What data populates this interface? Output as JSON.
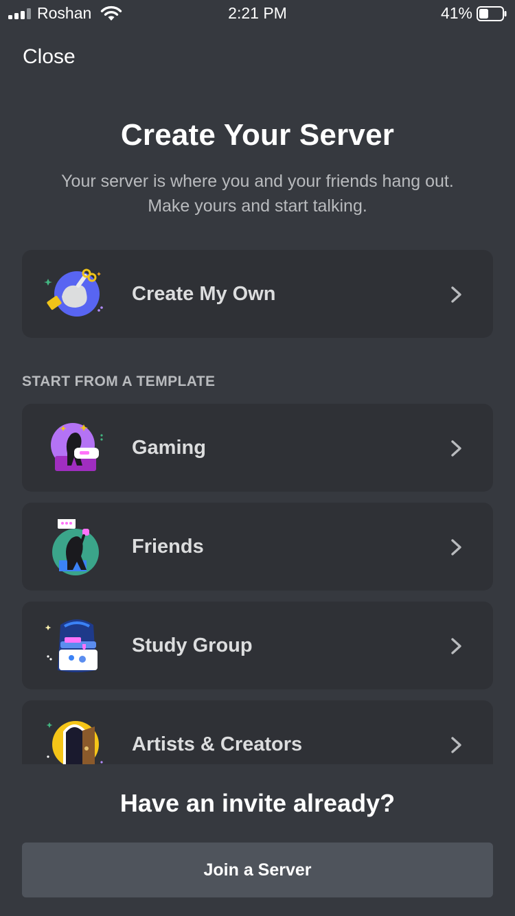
{
  "status_bar": {
    "carrier": "Roshan",
    "time": "2:21 PM",
    "battery": "41%"
  },
  "header": {
    "close_label": "Close"
  },
  "hero": {
    "title": "Create Your Server",
    "subtitle_line1": "Your server is where you and your friends hang out.",
    "subtitle_line2": "Make yours and start talking."
  },
  "create_own": {
    "label": "Create My Own"
  },
  "templates": {
    "header": "START FROM A TEMPLATE",
    "items": [
      {
        "label": "Gaming"
      },
      {
        "label": "Friends"
      },
      {
        "label": "Study Group"
      },
      {
        "label": "Artists & Creators"
      }
    ]
  },
  "invite": {
    "title": "Have an invite already?",
    "join_label": "Join a Server"
  },
  "colors": {
    "background": "#36393f",
    "card": "#2f3136",
    "button": "#4f545c",
    "muted_text": "#b9bbbe"
  }
}
